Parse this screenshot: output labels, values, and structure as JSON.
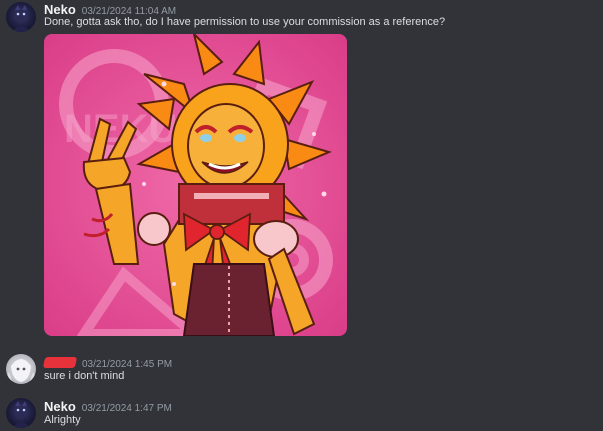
{
  "messages": [
    {
      "author": "Neko",
      "timestamp": "03/21/2024 11:04 AM",
      "text": "Done, gotta ask tho, do I have permission to use your commission as a reference?",
      "has_image": true
    },
    {
      "author": "",
      "timestamp": "03/21/2024 1:45 PM",
      "text": "sure i don't mind"
    },
    {
      "author": "Neko",
      "timestamp": "03/21/2024 1:47 PM",
      "text": "Alrighty"
    }
  ],
  "attachment": {
    "watermark_text": "NEKU & TA"
  },
  "colors": {
    "background": "#313338",
    "username": "#f2f3f5",
    "timestamp": "#949ba4",
    "message_text": "#dbdee1",
    "image_bg": "#e0458f",
    "redaction": "#e8323b"
  },
  "icons": {
    "avatar_neko": "dark-blue-character-avatar",
    "avatar_user2": "white-haired-character-avatar"
  }
}
